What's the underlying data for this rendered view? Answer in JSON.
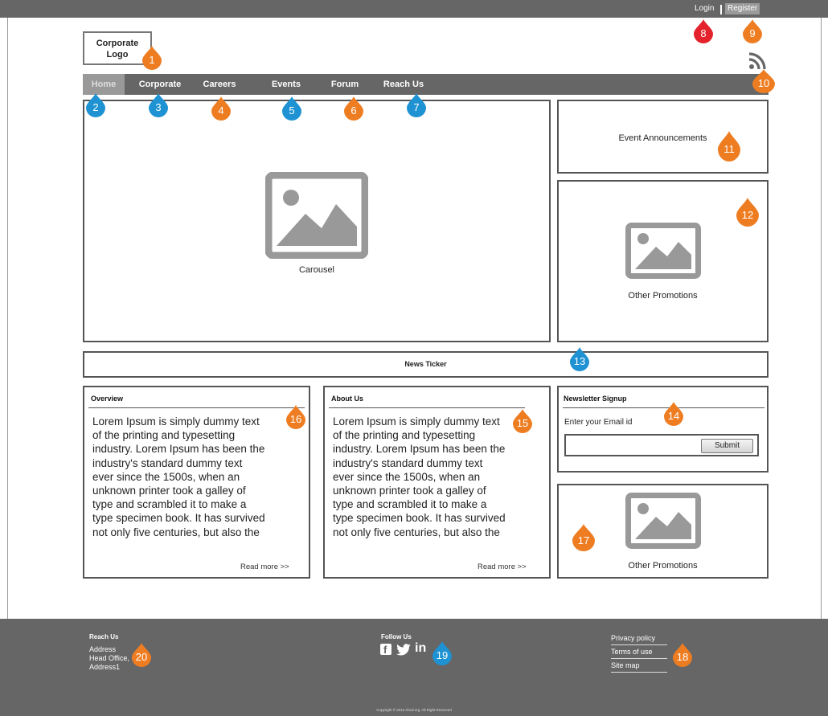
{
  "top_links": {
    "login": "Login",
    "register": "Register"
  },
  "logo": {
    "line1": "Corporate",
    "line2": "Logo"
  },
  "nav": [
    "Home",
    "Corporate",
    "Careers",
    "Events",
    "Forum",
    "Reach Us"
  ],
  "carousel": {
    "caption": "Carousel"
  },
  "events": {
    "label": "Event Announcements"
  },
  "promotions_top": {
    "caption": "Other Promotions"
  },
  "news_ticker": {
    "label": "News Ticker"
  },
  "overview": {
    "title": "Overview",
    "lines": [
      "Lorem Ipsum is simply dummy text",
      "of the printing and typesetting",
      "industry. Lorem Ipsum has been the",
      "industry's standard dummy text",
      "ever since the 1500s, when an",
      "unknown printer took a galley of",
      "type and scrambled it to make a",
      "type specimen book. It has survived",
      "not only five centuries, but also the"
    ],
    "read_more": "Read more >>"
  },
  "about": {
    "title": "About Us",
    "lines": [
      "Lorem Ipsum is simply dummy text",
      "of the printing and typesetting",
      "industry. Lorem Ipsum has been the",
      "industry's standard dummy text",
      "ever since the 1500s, when an",
      "unknown printer took a galley of",
      "type and scrambled it to make a",
      "type specimen book. It has survived",
      "not only five centuries, but also the"
    ],
    "read_more": "Read more >>"
  },
  "newsletter": {
    "title": "Newsletter Signup",
    "label": "Enter your Email id",
    "submit": "Submit"
  },
  "promotions_bottom": {
    "caption": "Other Promotions"
  },
  "footer": {
    "reach_title": "Reach Us",
    "address": [
      "Address",
      "Head Office,",
      "Address1"
    ],
    "follow_title": "Follow Us",
    "links": [
      "Privacy policy",
      "Terms of use",
      "Site map"
    ],
    "copyright": "Copyright © 2013 Abcd.org. All Right Reserved"
  },
  "markers": [
    {
      "n": "1",
      "color": "#ee7d22"
    },
    {
      "n": "2",
      "color": "#1e92d2"
    },
    {
      "n": "3",
      "color": "#1e92d2"
    },
    {
      "n": "4",
      "color": "#ee7d22"
    },
    {
      "n": "5",
      "color": "#1e92d2"
    },
    {
      "n": "6",
      "color": "#ee7d22"
    },
    {
      "n": "7",
      "color": "#1e92d2"
    },
    {
      "n": "8",
      "color": "#e4222b"
    },
    {
      "n": "9",
      "color": "#ee7d22"
    },
    {
      "n": "10",
      "color": "#ee7d22"
    },
    {
      "n": "11",
      "color": "#ee7d22"
    },
    {
      "n": "12",
      "color": "#ee7d22"
    },
    {
      "n": "13",
      "color": "#1e92d2"
    },
    {
      "n": "14",
      "color": "#ee7d22"
    },
    {
      "n": "15",
      "color": "#ee7d22"
    },
    {
      "n": "16",
      "color": "#ee7d22"
    },
    {
      "n": "17",
      "color": "#ee7d22"
    },
    {
      "n": "18",
      "color": "#ee7d22"
    },
    {
      "n": "19",
      "color": "#1e92d2"
    },
    {
      "n": "20",
      "color": "#ee7d22"
    }
  ],
  "colors": {
    "bar": "#666666",
    "border": "#555555",
    "placeholder": "#999999"
  }
}
